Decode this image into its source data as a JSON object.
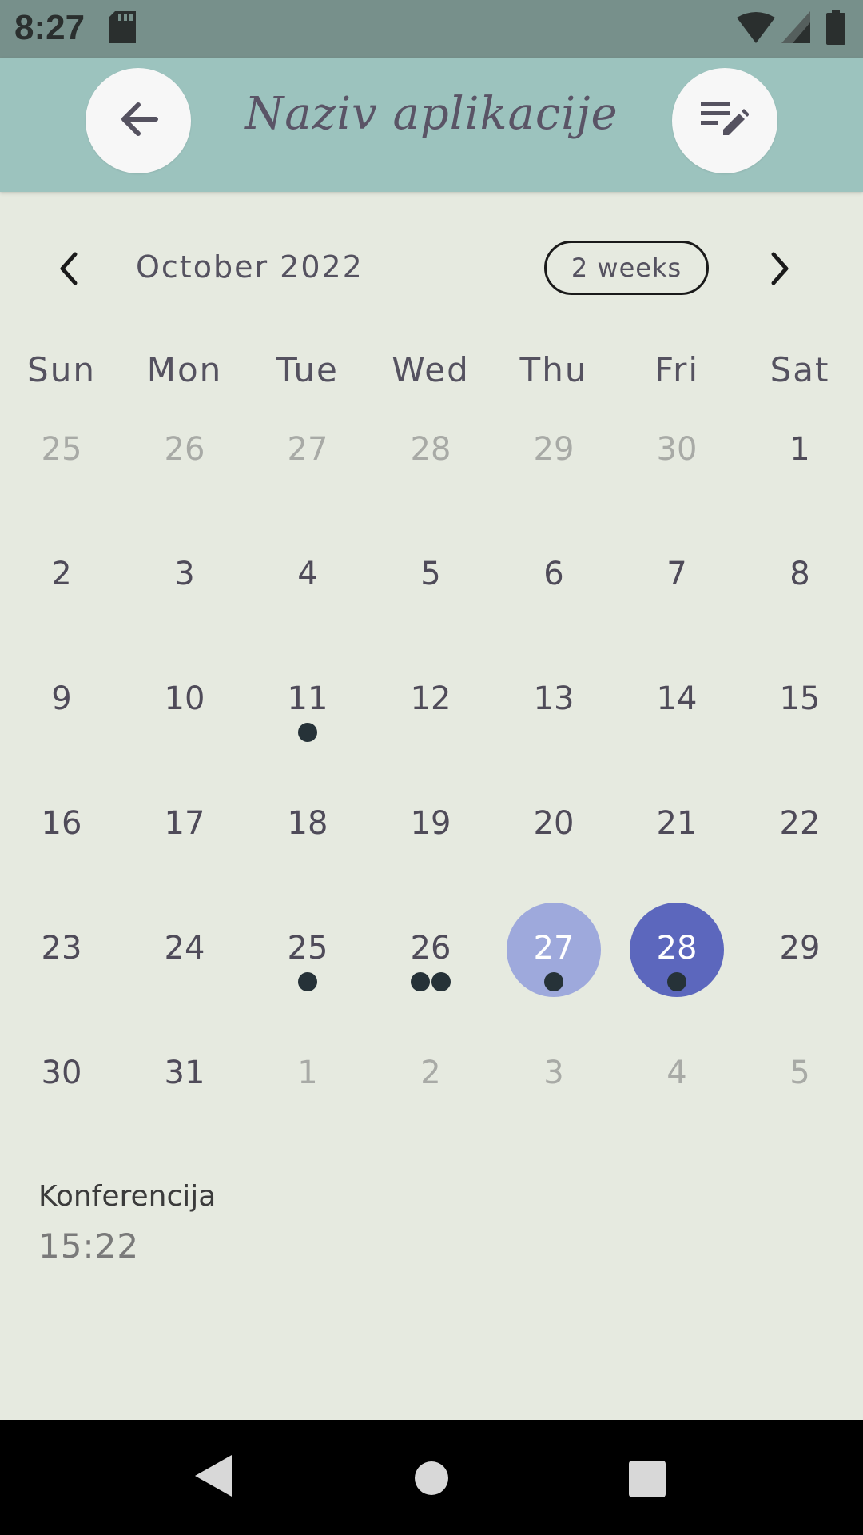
{
  "status_bar": {
    "time": "8:27"
  },
  "app_bar": {
    "title": "Naziv aplikacije"
  },
  "calendar": {
    "month": "October 2022",
    "format_button": "2 weeks",
    "weekdays": [
      "Sun",
      "Mon",
      "Tue",
      "Wed",
      "Thu",
      "Fri",
      "Sat"
    ],
    "weeks": [
      [
        {
          "d": "25",
          "o": true,
          "e": 0
        },
        {
          "d": "26",
          "o": true,
          "e": 0
        },
        {
          "d": "27",
          "o": true,
          "e": 0
        },
        {
          "d": "28",
          "o": true,
          "e": 0
        },
        {
          "d": "29",
          "o": true,
          "e": 0
        },
        {
          "d": "30",
          "o": true,
          "e": 0
        },
        {
          "d": "1",
          "o": false,
          "e": 0
        }
      ],
      [
        {
          "d": "2",
          "o": false,
          "e": 0
        },
        {
          "d": "3",
          "o": false,
          "e": 0
        },
        {
          "d": "4",
          "o": false,
          "e": 0
        },
        {
          "d": "5",
          "o": false,
          "e": 0
        },
        {
          "d": "6",
          "o": false,
          "e": 0
        },
        {
          "d": "7",
          "o": false,
          "e": 0
        },
        {
          "d": "8",
          "o": false,
          "e": 0
        }
      ],
      [
        {
          "d": "9",
          "o": false,
          "e": 0
        },
        {
          "d": "10",
          "o": false,
          "e": 0
        },
        {
          "d": "11",
          "o": false,
          "e": 1
        },
        {
          "d": "12",
          "o": false,
          "e": 0
        },
        {
          "d": "13",
          "o": false,
          "e": 0
        },
        {
          "d": "14",
          "o": false,
          "e": 0
        },
        {
          "d": "15",
          "o": false,
          "e": 0
        }
      ],
      [
        {
          "d": "16",
          "o": false,
          "e": 0
        },
        {
          "d": "17",
          "o": false,
          "e": 0
        },
        {
          "d": "18",
          "o": false,
          "e": 0
        },
        {
          "d": "19",
          "o": false,
          "e": 0
        },
        {
          "d": "20",
          "o": false,
          "e": 0
        },
        {
          "d": "21",
          "o": false,
          "e": 0
        },
        {
          "d": "22",
          "o": false,
          "e": 0
        }
      ],
      [
        {
          "d": "23",
          "o": false,
          "e": 0
        },
        {
          "d": "24",
          "o": false,
          "e": 0
        },
        {
          "d": "25",
          "o": false,
          "e": 1
        },
        {
          "d": "26",
          "o": false,
          "e": 2
        },
        {
          "d": "27",
          "o": false,
          "e": 1,
          "s": "light"
        },
        {
          "d": "28",
          "o": false,
          "e": 1,
          "s": "dark"
        },
        {
          "d": "29",
          "o": false,
          "e": 0
        }
      ],
      [
        {
          "d": "30",
          "o": false,
          "e": 0
        },
        {
          "d": "31",
          "o": false,
          "e": 0
        },
        {
          "d": "1",
          "o": true,
          "e": 0
        },
        {
          "d": "2",
          "o": true,
          "e": 0
        },
        {
          "d": "3",
          "o": true,
          "e": 0
        },
        {
          "d": "4",
          "o": true,
          "e": 0
        },
        {
          "d": "5",
          "o": true,
          "e": 0
        }
      ]
    ]
  },
  "event": {
    "title": "Konferencija",
    "time": "15:22"
  },
  "colors": {
    "app_bar": "#9cc3be",
    "background": "#e6eae0",
    "selected_light": "#9ea9dc",
    "selected_dark": "#5c67bd",
    "event_marker": "#263238"
  },
  "icons": {
    "back": "arrow-left-icon",
    "edit": "edit-list-icon",
    "prev_month": "chevron-left-icon",
    "next_month": "chevron-right-icon"
  }
}
